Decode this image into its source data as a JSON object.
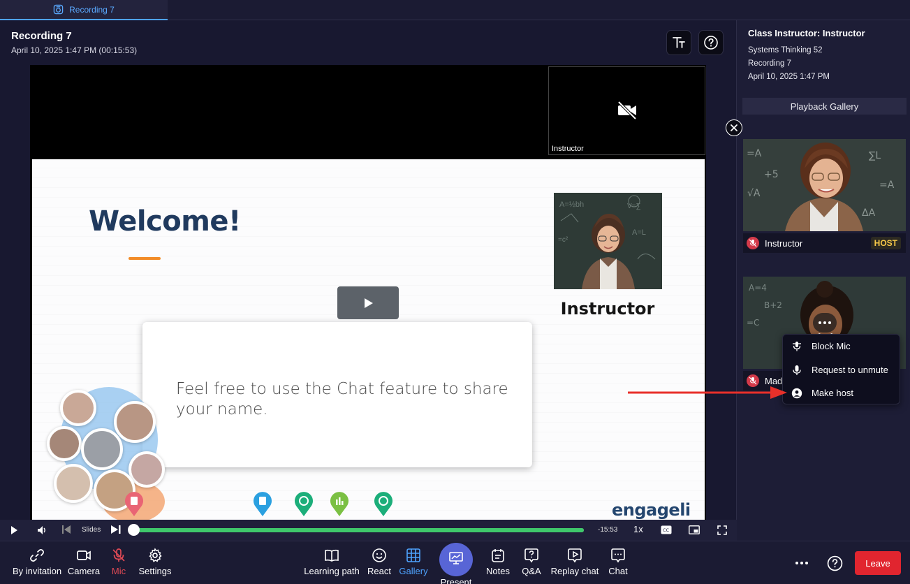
{
  "tab": {
    "label": "Recording 7",
    "icon": "recording-icon"
  },
  "recording": {
    "title": "Recording 7",
    "datetime": "April 10, 2025 1:47 PM (00:15:53)"
  },
  "camera_tile": {
    "label": "Instructor",
    "icon": "camera-off-icon"
  },
  "slide": {
    "heading": "Welcome!",
    "instructor_label": "Instructor",
    "card_text": "Feel free to use the Chat feature to share your name.",
    "logo_text": "engageli"
  },
  "playback": {
    "slides_label": "Slides",
    "time_remaining": "-15:53",
    "speed": "1x",
    "progress": 0.0
  },
  "sidebar": {
    "title": "Class Instructor: Instructor",
    "course": "Systems Thinking 52",
    "recording": "Recording 7",
    "date": "April 10, 2025 1:47 PM",
    "gallery_header": "Playback Gallery",
    "participants": [
      {
        "name": "Instructor",
        "badge": "HOST",
        "mic_muted": true
      },
      {
        "name": "Mad",
        "mic_muted": true
      }
    ]
  },
  "context_menu": {
    "items": [
      {
        "label": "Block Mic",
        "icon": "block-mic-icon"
      },
      {
        "label": "Request to unmute",
        "icon": "mic-icon"
      },
      {
        "label": "Make host",
        "icon": "user-circle-icon"
      }
    ]
  },
  "toolbar": {
    "left": [
      {
        "label": "By invitation",
        "icon": "invitation-icon"
      },
      {
        "label": "Camera",
        "icon": "camera-icon"
      },
      {
        "label": "Mic",
        "icon": "mic-off-icon",
        "state": "muted"
      },
      {
        "label": "Settings",
        "icon": "gear-icon"
      }
    ],
    "center": [
      {
        "label": "Learning path",
        "icon": "book-icon"
      },
      {
        "label": "React",
        "icon": "smile-icon"
      },
      {
        "label": "Gallery",
        "icon": "grid-icon",
        "state": "active"
      },
      {
        "label": "Present",
        "icon": "present-icon"
      },
      {
        "label": "Notes",
        "icon": "notes-icon"
      },
      {
        "label": "Q&A",
        "icon": "question-bubble-icon"
      },
      {
        "label": "Replay chat",
        "icon": "replay-chat-icon"
      },
      {
        "label": "Chat",
        "icon": "chat-icon"
      }
    ],
    "leave_label": "Leave"
  },
  "colors": {
    "accent": "#4ea3ff",
    "leave": "#e1252f",
    "host": "#f7c948",
    "progress": "#3fc86b",
    "muted": "#d33a4a"
  }
}
